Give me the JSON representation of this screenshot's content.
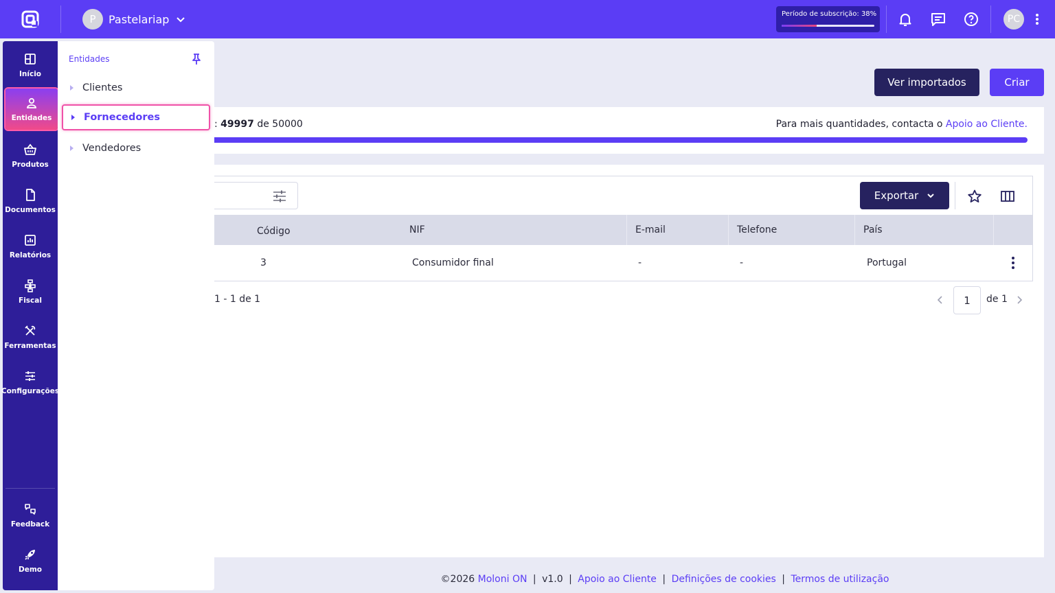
{
  "header": {
    "company_initial": "P",
    "company_name": "Pastelariap",
    "subscription_label": "Período de subscrição: 38%",
    "subscription_progress": 0.38,
    "user_initials": "PC"
  },
  "sidebar": {
    "items": [
      {
        "label": "Início",
        "icon": "grid-icon"
      },
      {
        "label": "Entidades",
        "icon": "user-icon"
      },
      {
        "label": "Produtos",
        "icon": "basket-icon"
      },
      {
        "label": "Documentos",
        "icon": "document-icon"
      },
      {
        "label": "Relatórios",
        "icon": "chart-icon"
      },
      {
        "label": "Fiscal",
        "icon": "fiscal-icon"
      },
      {
        "label": "Ferramentas",
        "icon": "tools-icon"
      },
      {
        "label": "Configurações",
        "icon": "sliders-icon"
      }
    ],
    "bottom": [
      {
        "label": "Feedback",
        "icon": "feedback-icon"
      },
      {
        "label": "Demo",
        "icon": "rocket-icon"
      }
    ]
  },
  "flyout": {
    "title": "Entidades",
    "items": [
      "Clientes",
      "Fornecedores",
      "Vendedores"
    ],
    "active": "Fornecedores"
  },
  "actions": {
    "import_label": "Ver importados",
    "create_label": "Criar"
  },
  "quota": {
    "prefix": ":",
    "used": "49997",
    "of_word": "de",
    "total": "50000",
    "fill_fraction": 1.0,
    "right_text": "Para mais quantidades, contacta o",
    "right_link": "Apoio ao Cliente."
  },
  "toolbar": {
    "export_label": "Exportar"
  },
  "table": {
    "columns": [
      "Código",
      "NIF",
      "E-mail",
      "Telefone",
      "País"
    ],
    "rows": [
      {
        "codigo": "3",
        "nif": "Consumidor final",
        "email": "-",
        "telefone": "-",
        "pais": "Portugal"
      }
    ]
  },
  "pagination": {
    "range": "1 - 1 de 1",
    "page": "1",
    "of_pages": "de 1"
  },
  "footer": {
    "copyright": "©2026",
    "brand": "Moloni ON",
    "version": "v1.0",
    "support": "Apoio ao Cliente",
    "cookies": "Definições de cookies",
    "terms": "Termos de utilização"
  },
  "colors": {
    "brand": "#5b3df5",
    "sidebar": "#2e1e99",
    "dark_button": "#26225f",
    "highlight": "#f052a8"
  }
}
